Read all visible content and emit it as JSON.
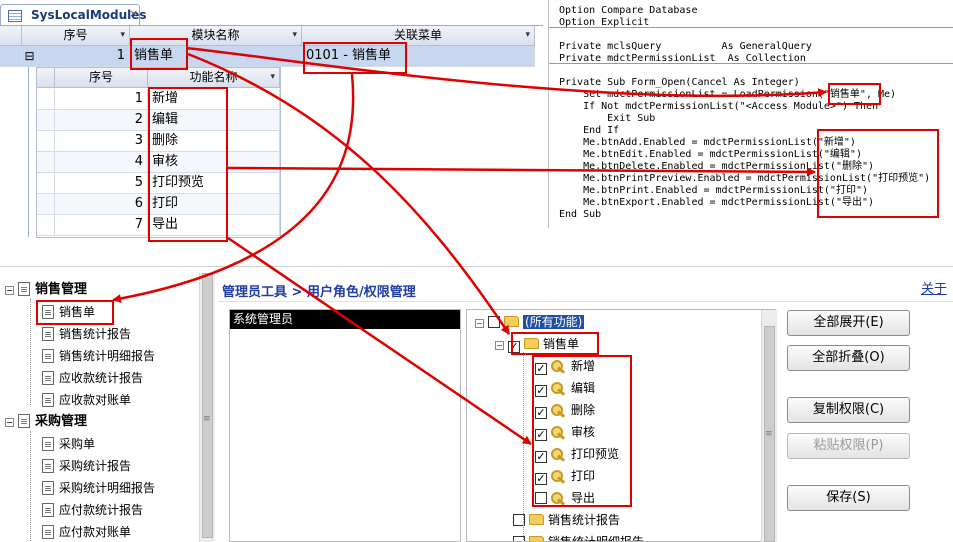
{
  "datasheet": {
    "tab_title": "SysLocalModules",
    "close_glyph": "×",
    "main_headers": [
      "序号",
      "模块名称",
      "关联菜单"
    ],
    "main_row": {
      "seq": "1",
      "module": "销售单",
      "menu": "0101 - 销售单"
    },
    "expand_glyph": "⊟",
    "sub_headers": [
      "序号",
      "功能名称"
    ],
    "sub_rows": [
      {
        "seq": "1",
        "name": "新增"
      },
      {
        "seq": "2",
        "name": "编辑"
      },
      {
        "seq": "3",
        "name": "删除"
      },
      {
        "seq": "4",
        "name": "审核"
      },
      {
        "seq": "5",
        "name": "打印预览"
      },
      {
        "seq": "6",
        "name": "打印"
      },
      {
        "seq": "7",
        "name": "导出"
      }
    ]
  },
  "code": {
    "lines": [
      "Option Compare Database",
      "Option Explicit",
      "",
      "Private mclsQuery          As GeneralQuery",
      "Private mdctPermissionList  As Collection",
      "",
      "Private Sub Form_Open(Cancel As Integer)",
      "    Set mdctPermissionList = LoadPermission(\"销售单\", Me)",
      "    If Not mdctPermissionList(\"<Access Module>\") Then",
      "        Exit Sub",
      "    End If",
      "    Me.btnAdd.Enabled = mdctPermissionList(\"新增\")",
      "    Me.btnEdit.Enabled = mdctPermissionList(\"编辑\")",
      "    Me.btnDelete.Enabled = mdctPermissionList(\"删除\")",
      "    Me.btnPrintPreview.Enabled = mdctPermissionList(\"打印预览\")",
      "    Me.btnPrint.Enabled = mdctPermissionList(\"打印\")",
      "    Me.btnExport.Enabled = mdctPermissionList(\"导出\")",
      "End Sub"
    ]
  },
  "nav_tree": {
    "groups": [
      {
        "label": "销售管理",
        "items": [
          "销售单",
          "销售统计报告",
          "销售统计明细报告",
          "应收款统计报告",
          "应收款对账单"
        ]
      },
      {
        "label": "采购管理",
        "items": [
          "采购单",
          "采购统计报告",
          "采购统计明细报告",
          "应付款统计报告",
          "应付款对账单"
        ]
      }
    ]
  },
  "perm": {
    "breadcrumb": "管理员工具 > 用户角色/权限管理",
    "close_link": "关于",
    "role": "系统管理员",
    "root": "(所有功能)",
    "module": "销售单",
    "functions": [
      {
        "label": "新增",
        "checked": true
      },
      {
        "label": "编辑",
        "checked": true
      },
      {
        "label": "删除",
        "checked": true
      },
      {
        "label": "审核",
        "checked": true
      },
      {
        "label": "打印预览",
        "checked": true
      },
      {
        "label": "打印",
        "checked": true
      },
      {
        "label": "导出",
        "checked": false
      }
    ],
    "more_modules": [
      "销售统计报告",
      "销售统计明细报告"
    ],
    "buttons": {
      "expand_all": "全部展开(E)",
      "collapse_all": "全部折叠(O)",
      "copy": "复制权限(C)",
      "paste": "粘贴权限(P)",
      "save": "保存(S)"
    },
    "check_glyph": "✓"
  },
  "colors": {
    "annotation": "#e00000",
    "link": "#1f3da8",
    "selection": "#1f4fa8"
  }
}
